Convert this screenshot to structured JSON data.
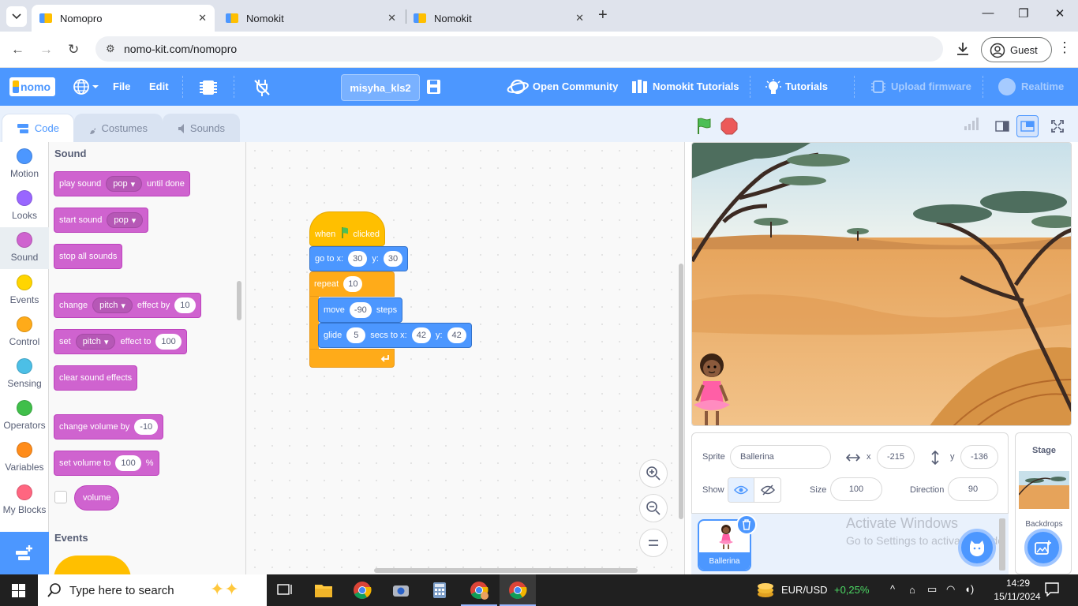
{
  "browser": {
    "tabs": [
      {
        "title": "Nomopro",
        "active": true
      },
      {
        "title": "Nomokit",
        "active": false
      },
      {
        "title": "Nomokit",
        "active": false
      }
    ],
    "url": "nomo-kit.com/nomopro",
    "profile_label": "Guest"
  },
  "menubar": {
    "logo_text": "nomo",
    "file_label": "File",
    "edit_label": "Edit",
    "project_name": "misyha_kls2",
    "open_community_label": "Open Community",
    "nomokit_tutorials_label": "Nomokit Tutorials",
    "tutorials_label": "Tutorials",
    "upload_firmware_label": "Upload firmware",
    "realtime_label": "Realtime"
  },
  "editor_tabs": {
    "code": "Code",
    "costumes": "Costumes",
    "sounds": "Sounds"
  },
  "categories": [
    {
      "label": "Motion",
      "color": "#4c97ff"
    },
    {
      "label": "Looks",
      "color": "#9966ff"
    },
    {
      "label": "Sound",
      "color": "#cf63cf"
    },
    {
      "label": "Events",
      "color": "#ffd500"
    },
    {
      "label": "Control",
      "color": "#ffab19"
    },
    {
      "label": "Sensing",
      "color": "#4cbfe6"
    },
    {
      "label": "Operators",
      "color": "#40bf4a"
    },
    {
      "label": "Variables",
      "color": "#ff8c1a"
    },
    {
      "label": "My Blocks",
      "color": "#ff6680"
    }
  ],
  "palette": {
    "sound_heading": "Sound",
    "play_sound": {
      "prefix": "play sound",
      "sound": "pop",
      "suffix": "until done"
    },
    "start_sound": {
      "prefix": "start sound",
      "sound": "pop"
    },
    "stop_all_sounds": "stop all sounds",
    "change_effect": {
      "prefix": "change",
      "effect": "pitch",
      "mid": "effect by",
      "value": "10"
    },
    "set_effect": {
      "prefix": "set",
      "effect": "pitch",
      "mid": "effect to",
      "value": "100"
    },
    "clear_sound_effects": "clear sound effects",
    "change_volume": {
      "prefix": "change volume by",
      "value": "-10"
    },
    "set_volume": {
      "prefix": "set volume to",
      "value": "100",
      "suffix": "%"
    },
    "volume_reporter": "volume",
    "events_heading": "Events"
  },
  "script": {
    "hat": {
      "when": "when",
      "clicked": "clicked"
    },
    "goto": {
      "label": "go to x:",
      "x": "30",
      "ylabel": "y:",
      "y": "30"
    },
    "repeat": {
      "label": "repeat",
      "times": "10"
    },
    "move": {
      "label": "move",
      "steps": "-90",
      "suffix": "steps"
    },
    "glide": {
      "label": "glide",
      "secs": "5",
      "mid": "secs to x:",
      "x": "42",
      "ylabel": "y:",
      "y": "42"
    }
  },
  "sprite_info": {
    "sprite_label": "Sprite",
    "sprite_name": "Ballerina",
    "x_label": "x",
    "x_value": "-215",
    "y_label": "y",
    "y_value": "-136",
    "show_label": "Show",
    "size_label": "Size",
    "size_value": "100",
    "direction_label": "Direction",
    "direction_value": "90",
    "sprite_thumb_label": "Ballerina"
  },
  "stage_pane": {
    "title": "Stage",
    "backdrops_label": "Backdrops"
  },
  "watermark": {
    "line1": "Activate Windows",
    "line2": "Go to Settings to activate Windows."
  },
  "taskbar": {
    "search_placeholder": "Type here to search",
    "ticker": "EUR/USD",
    "ticker_change": "+0,25%",
    "time": "14:29",
    "date": "15/11/2024"
  },
  "colors": {
    "accent": "#4c97ff",
    "sound": "#cf63cf",
    "motion": "#4c97ff",
    "events": "#ffbf00",
    "control": "#ffab19"
  }
}
